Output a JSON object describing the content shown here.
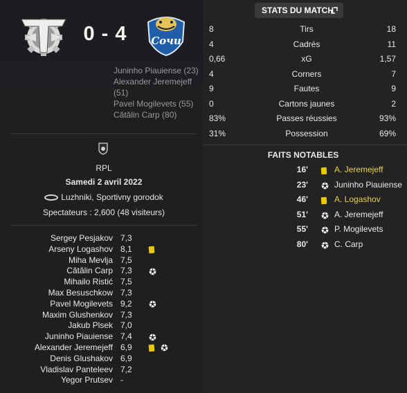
{
  "match": {
    "score": "0 - 4",
    "home_crest": "torpedo-crest-icon",
    "away_crest": "sochi-crest-icon"
  },
  "scorers": [
    "Juninho Piauiense (23)",
    "Alexander Jeremejeff (51)",
    "Pavel Mogilevets (55)",
    "Cătălin Carp (80)"
  ],
  "info": {
    "league": "RPL",
    "date": "Samedi 2 avril 2022",
    "stadium": "Luzhniki, Sportivny gorodok",
    "attendance": "Spectateurs : 2,600 (48 visiteurs)"
  },
  "players": [
    {
      "name": "Sergey Pesjakov",
      "rating": "7,3",
      "events": []
    },
    {
      "name": "Arseny Logashov",
      "rating": "8,1",
      "events": [
        "yellow-card"
      ]
    },
    {
      "name": "Miha Mevlja",
      "rating": "7,5",
      "events": []
    },
    {
      "name": "Cătălin Carp",
      "rating": "7,3",
      "events": [
        "goal"
      ]
    },
    {
      "name": "Mihailo Ristić",
      "rating": "7,5",
      "events": []
    },
    {
      "name": "Max Besuschkow",
      "rating": "7,3",
      "events": []
    },
    {
      "name": "Pavel Mogilevets",
      "rating": "9,2",
      "events": [
        "goal"
      ]
    },
    {
      "name": "Maxim Glushenkov",
      "rating": "7,3",
      "events": []
    },
    {
      "name": "Jakub Plsek",
      "rating": "7,0",
      "events": []
    },
    {
      "name": "Juninho Piauiense",
      "rating": "7,4",
      "events": [
        "goal"
      ]
    },
    {
      "name": "Alexander Jeremejeff",
      "rating": "6,9",
      "events": [
        "yellow-card",
        "goal"
      ]
    },
    {
      "name": "Denis Glushakov",
      "rating": "6,9",
      "events": []
    },
    {
      "name": "Vladislav Panteleev",
      "rating": "7,2",
      "events": []
    },
    {
      "name": "Yegor Prutsev",
      "rating": "-",
      "events": []
    }
  ],
  "stats": {
    "button_label": "STATS DU MATCH",
    "rows": [
      {
        "label": "Tirs",
        "home": "8",
        "away": "18"
      },
      {
        "label": "Cadrés",
        "home": "4",
        "away": "11"
      },
      {
        "label": "xG",
        "home": "0,66",
        "away": "1,57"
      },
      {
        "label": "Corners",
        "home": "4",
        "away": "7"
      },
      {
        "label": "Fautes",
        "home": "9",
        "away": "9"
      },
      {
        "label": "Cartons jaunes",
        "home": "0",
        "away": "2"
      },
      {
        "label": "Passes réussies",
        "home": "83%",
        "away": "93%"
      },
      {
        "label": "Possession",
        "home": "31%",
        "away": "69%"
      }
    ]
  },
  "events": {
    "title": "FAITS NOTABLES",
    "items": [
      {
        "minute": "16'",
        "type": "yellow-card",
        "player": "A. Jeremejeff",
        "highlight": true
      },
      {
        "minute": "23'",
        "type": "goal",
        "player": "Juninho Piauiense",
        "highlight": false
      },
      {
        "minute": "46'",
        "type": "yellow-card",
        "player": "A. Logashov",
        "highlight": true
      },
      {
        "minute": "51'",
        "type": "goal",
        "player": "A. Jeremejeff",
        "highlight": false
      },
      {
        "minute": "55'",
        "type": "goal",
        "player": "P. Mogilevets",
        "highlight": false
      },
      {
        "minute": "80'",
        "type": "goal",
        "player": "C. Carp",
        "highlight": false
      }
    ]
  },
  "colors": {
    "yellow_card": "#e8c800",
    "highlight_text": "#e8d24b",
    "background": "#1f1f1f"
  }
}
